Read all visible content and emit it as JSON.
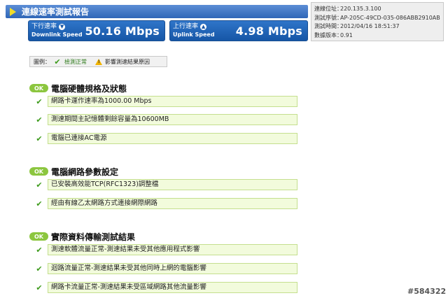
{
  "header": {
    "title": "連線速率測試報告"
  },
  "downlink": {
    "label_zh": "下行速率",
    "label_en": "Downlink Speed",
    "value": "50.16 Mbps"
  },
  "uplink": {
    "label_zh": "上行速率",
    "label_en": "Uplink Speed",
    "value": "4.98 Mbps"
  },
  "info": {
    "rows": [
      {
        "key": "連線位址：",
        "value": "220.135.3.100"
      },
      {
        "key": "測試序號：",
        "value": "AP-205C-49CD-035-086ABB2910AB"
      },
      {
        "key": "測試時間：",
        "value": "2012/04/16 18:51:37"
      },
      {
        "key": "數據版本：",
        "value": "0.91"
      }
    ]
  },
  "legend": {
    "label": "圖例：",
    "ok": "檢測正常",
    "warn": "影響測速結果原因"
  },
  "ok_badge": "OK",
  "sections": [
    {
      "title": "電腦硬體規格及狀態",
      "items": [
        "網路卡運作速率為1000.00 Mbps",
        "測速期間主記憶體剩餘容量為10600MB",
        "電腦已連接AC電源"
      ]
    },
    {
      "title": "電腦網路參數設定",
      "items": [
        "已安裝高效能TCP(RFC1323)調整檔",
        "經由有線乙太網路方式連接網際網路"
      ]
    },
    {
      "title": "實際資料傳輸測試結果",
      "items": [
        "測速軟體流量正常-測速結果未受其他應用程式影響",
        "迴路流量正常-測速結果未受其他同時上網的電腦影響",
        "網路卡流量正常-測速結果未受區域網路其他流量影響"
      ]
    }
  ],
  "watermark": "#584322",
  "colors": {
    "title_bar": "#2f66b7",
    "speed_box": "#1656a6",
    "ok_badge": "#8cc63f",
    "item_bg": "#f2fbdc",
    "check": "#3d9b1c"
  }
}
